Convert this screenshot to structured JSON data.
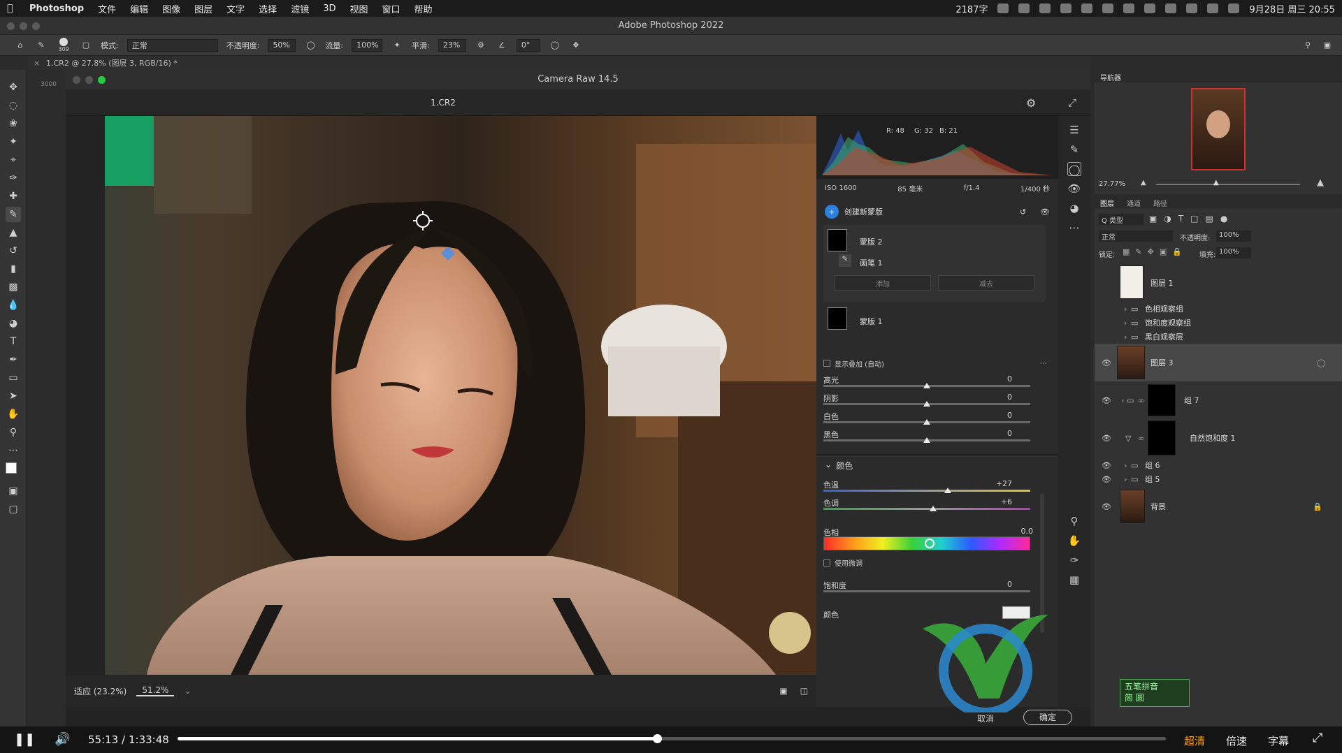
{
  "menubar": {
    "app": "Photoshop",
    "items": [
      "文件",
      "编辑",
      "图像",
      "图层",
      "文字",
      "选择",
      "滤镜",
      "3D",
      "视图",
      "窗口",
      "帮助"
    ],
    "status_text": "2187字",
    "datetime": "9月28日 周三 20:55"
  },
  "window": {
    "title": "Adobe Photoshop 2022"
  },
  "options": {
    "mode_label": "模式:",
    "mode_value": "正常",
    "opacity_label": "不透明度:",
    "opacity_value": "50%",
    "flow_label": "流量:",
    "flow_value": "100%",
    "smooth_label": "平滑:",
    "smooth_value": "23%",
    "angle_value": "0°",
    "brush_size": "309"
  },
  "doc_tab": {
    "label": "1.CR2 @ 27.8% (图层 3, RGB/16) *"
  },
  "ruler": {
    "label": "3000"
  },
  "acr": {
    "title": "Camera Raw 14.5",
    "file_name": "1.CR2",
    "histogram": {
      "r": "R: 48",
      "g": "G: 32",
      "b": "B: 21"
    },
    "exif": {
      "iso": "ISO 1600",
      "focal": "85 毫米",
      "aperture": "f/1.4",
      "shutter": "1/400 秒"
    },
    "mask_header": "创建新蒙版",
    "masks": [
      {
        "name": "蒙版 2"
      },
      {
        "name": "画笔 1"
      },
      {
        "name": "蒙版 1"
      }
    ],
    "add_label": "添加",
    "subtract_label": "减去",
    "overlay_label": "显示叠加 (自动)",
    "tone_sliders": [
      {
        "label": "高光",
        "value": "0",
        "pos": 0.5
      },
      {
        "label": "阴影",
        "value": "0",
        "pos": 0.5
      },
      {
        "label": "白色",
        "value": "0",
        "pos": 0.5
      },
      {
        "label": "黑色",
        "value": "0",
        "pos": 0.5
      }
    ],
    "color_section": "颜色",
    "color_sliders": [
      {
        "label": "色温",
        "value": "+27",
        "pos": 0.6
      },
      {
        "label": "色调",
        "value": "+6",
        "pos": 0.53
      }
    ],
    "hue_label": "色相",
    "hue_value": "0.0",
    "fine_adjust_label": "使用微调",
    "saturation_label": "饱和度",
    "saturation_value": "0",
    "color_label": "颜色",
    "cancel_label": "取消",
    "ok_label": "确定",
    "zoom_fit": "适应 (23.2%)",
    "zoom_value": "51.2%"
  },
  "navigator": {
    "title": "导航器",
    "zoom": "27.77%"
  },
  "layers_panel": {
    "tabs": [
      "图层",
      "通道",
      "路径"
    ],
    "filter_label": "Q 类型",
    "blend_mode": "正常",
    "opacity_label": "不透明度:",
    "opacity_value": "100%",
    "lock_label": "锁定:",
    "fill_label": "填充:",
    "fill_value": "100%",
    "layers": [
      {
        "name": "图层 1"
      },
      {
        "name": "色相观察组"
      },
      {
        "name": "饱和度观察组"
      },
      {
        "name": "黑白观察层"
      },
      {
        "name": "图层 3"
      },
      {
        "name": "组 7"
      },
      {
        "name": "自然饱和度 1"
      },
      {
        "name": "组 6"
      },
      {
        "name": "组 5"
      },
      {
        "name": "背景"
      }
    ]
  },
  "ime": {
    "line1": "五笔拼音",
    "line2": "简 圆"
  },
  "player": {
    "current_time": "55:13",
    "separator": "/",
    "total_time": "1:33:48",
    "progress": 0.485,
    "quality": "超清",
    "speed": "倍速",
    "subtitle": "字幕"
  },
  "colors": {
    "accent_blue": "#2d7fe0",
    "quality_orange": "#f0a020"
  }
}
